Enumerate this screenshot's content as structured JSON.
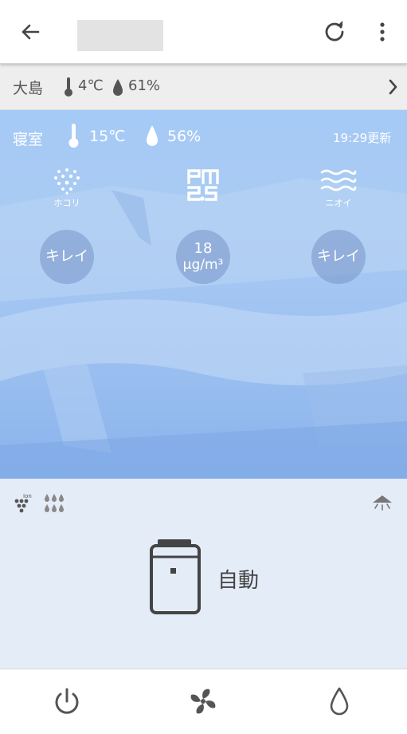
{
  "appbar": {
    "back_icon": "arrow-back-icon",
    "refresh_icon": "refresh-icon",
    "more_icon": "more-vert-icon"
  },
  "outdoor": {
    "location": "大島",
    "temperature": "4℃",
    "humidity": "61%"
  },
  "room": {
    "name": "寝室",
    "temperature": "15℃",
    "humidity": "56%",
    "updated": "19:29更新",
    "sensors": [
      {
        "icon": "dust-icon",
        "label": "ホコリ",
        "status": "キレイ"
      },
      {
        "icon": "pm25-icon",
        "value": "18",
        "unit": "μg/m³"
      },
      {
        "icon": "odor-icon",
        "label": "ニオイ",
        "status": "キレイ"
      }
    ]
  },
  "mode": {
    "label": "自動",
    "indicators": [
      "ion-icon",
      "humidify-icon",
      "lamp-icon"
    ]
  },
  "bottom": {
    "buttons": [
      "power-icon",
      "fan-icon",
      "water-drop-icon"
    ]
  },
  "colors": {
    "room_bg": "#a6caf6",
    "mode_bg": "#e4ecf7",
    "icon_gray": "#555555"
  }
}
